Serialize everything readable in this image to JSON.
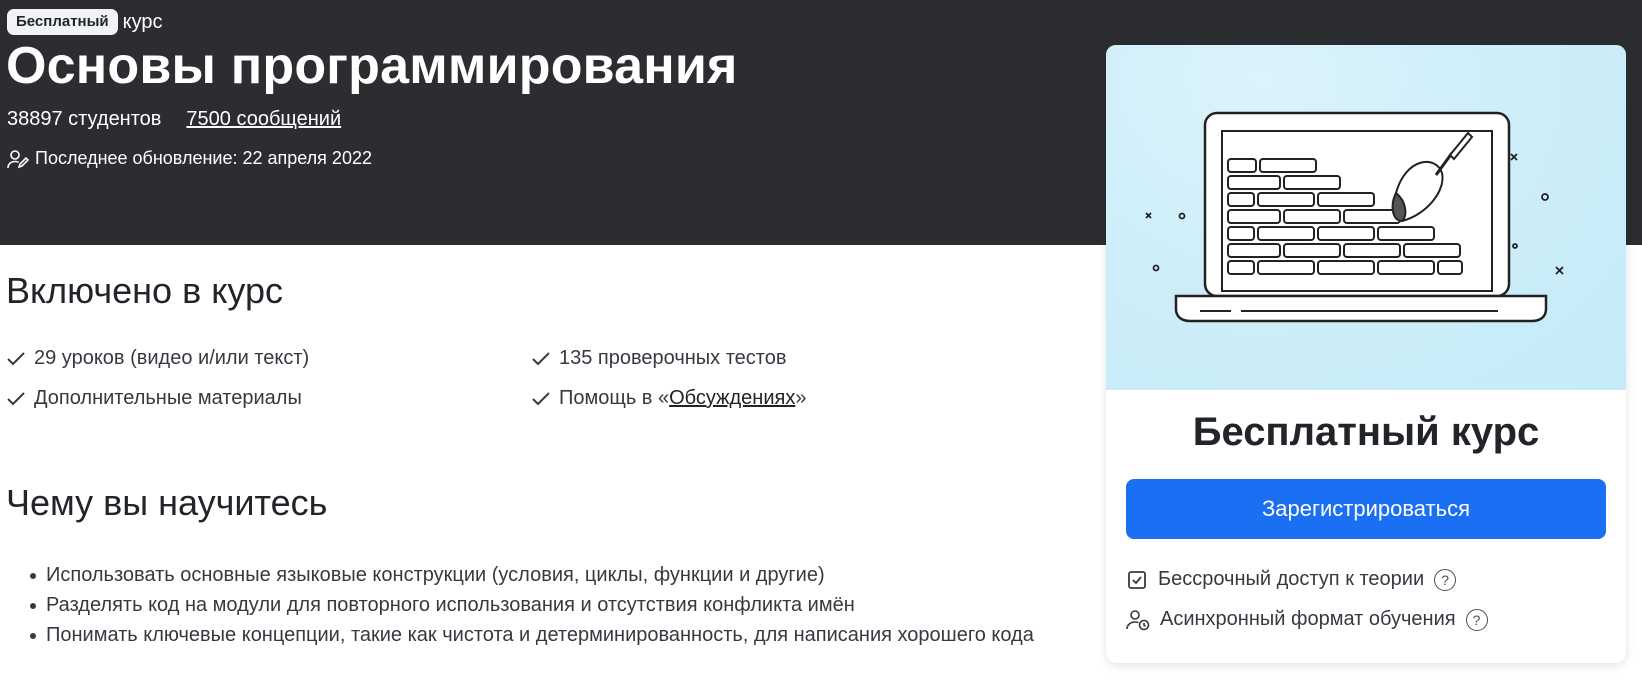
{
  "hero": {
    "badge": "Бесплатный",
    "badge_suffix": "курс",
    "title": "Основы программирования",
    "students": "38897 студентов",
    "messages_link": "7500 сообщений",
    "last_update": "Последнее обновление: 22 апреля 2022"
  },
  "included": {
    "heading": "Включено в курс",
    "items": [
      "29 уроков (видео и/или текст)",
      "135 проверочных тестов",
      "Дополнительные материалы"
    ],
    "help_prefix": "Помощь в «",
    "help_link": "Обсуждениях",
    "help_suffix": "»"
  },
  "learn": {
    "heading": "Чему вы научитесь",
    "items": [
      "Использовать основные языковые конструкции (условия, циклы, функции и другие)",
      "Разделять код на модули для повторного использования и отсутствия конфликта имён",
      "Понимать ключевые концепции, такие как чистота и детерминированность, для написания хорошего кода"
    ]
  },
  "card": {
    "price": "Бесплатный курс",
    "register_label": "Зарегистрироваться",
    "features": [
      "Бессрочный доступ к теории",
      "Асинхронный формат обучения"
    ],
    "help_glyph": "?",
    "illustration_icon": "laptop-brick-wall-illustration"
  },
  "colors": {
    "hero_bg": "#2b2d31",
    "primary": "#1a6ff2",
    "illustration_bg": "#cdeef9"
  }
}
